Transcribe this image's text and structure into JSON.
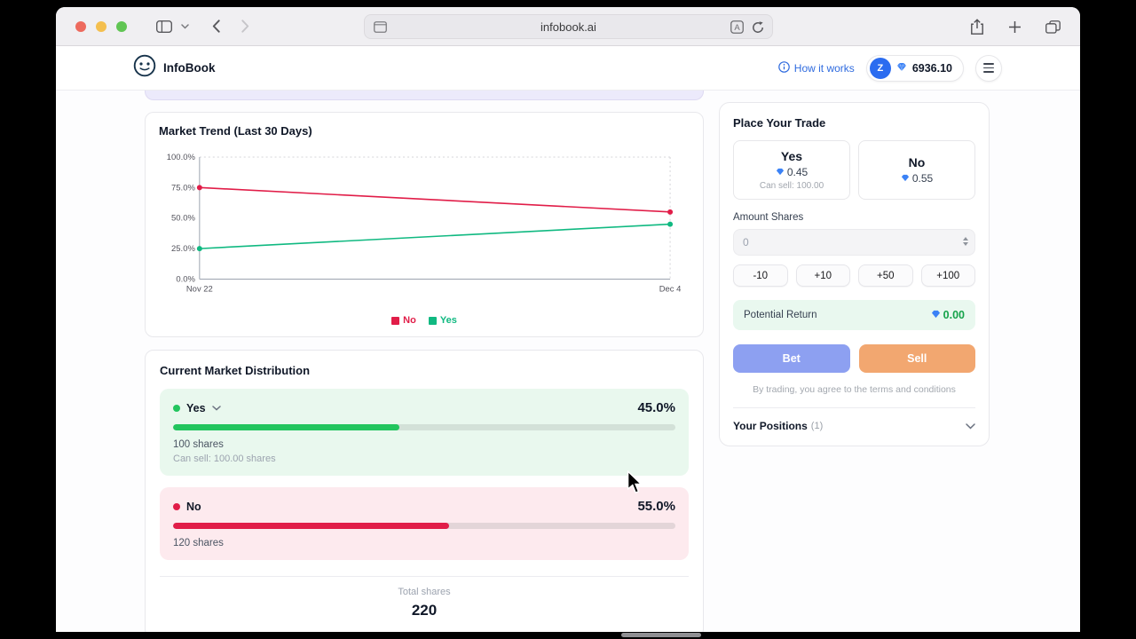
{
  "browser": {
    "url": "infobook.ai"
  },
  "header": {
    "brand": "InfoBook",
    "how_it_works": "How it works",
    "avatar": "Z",
    "balance": "6936.10"
  },
  "colors": {
    "yes": "#22c55e",
    "no": "#e11d48",
    "accent_blue": "#3b82f6",
    "bet_button": "#8da0f1",
    "sell_button": "#f2a770",
    "return_green": "#16a34a"
  },
  "chart_data": {
    "type": "line",
    "title": "Market Trend (Last 30 Days)",
    "x": [
      "Nov 22",
      "Dec 4"
    ],
    "series": [
      {
        "name": "No",
        "color": "#e11d48",
        "values": [
          75.0,
          55.0
        ]
      },
      {
        "name": "Yes",
        "color": "#10b981",
        "values": [
          25.0,
          45.0
        ]
      }
    ],
    "ylim": [
      0,
      100
    ],
    "yticks": [
      {
        "value": 100,
        "label": "100.0%"
      },
      {
        "value": 75,
        "label": "75.0%"
      },
      {
        "value": 50,
        "label": "50.0%"
      },
      {
        "value": 25,
        "label": "25.0%"
      },
      {
        "value": 0,
        "label": "0.0%"
      }
    ],
    "legend_position": "bottom",
    "grid": "dotted top and right border, solid left and bottom axes"
  },
  "distribution_card": {
    "title": "Current Market Distribution",
    "rows": [
      {
        "label": "Yes",
        "percent_label": "45.0%",
        "percent": 45,
        "shares": "100 shares",
        "can_sell": "Can sell: 100.00 shares",
        "color": "#22c55e",
        "bg": "#e9f8ee"
      },
      {
        "label": "No",
        "percent_label": "55.0%",
        "percent": 55,
        "shares": "120 shares",
        "color": "#e11d48",
        "bg": "#fdeaee"
      }
    ],
    "total_label": "Total shares",
    "total_value": "220"
  },
  "trade_card": {
    "title": "Place Your Trade",
    "options": [
      {
        "label": "Yes",
        "price": "0.45",
        "can_sell": "Can sell: 100.00"
      },
      {
        "label": "No",
        "price": "0.55"
      }
    ],
    "amount_label": "Amount Shares",
    "amount_value": "0",
    "quick_amounts": [
      "-10",
      "+10",
      "+50",
      "+100"
    ],
    "potential_return_label": "Potential Return",
    "potential_return_value": "0.00",
    "bet_label": "Bet",
    "sell_label": "Sell",
    "terms": "By trading, you agree to the terms and conditions",
    "positions_label": "Your Positions",
    "positions_count": "(1)"
  }
}
